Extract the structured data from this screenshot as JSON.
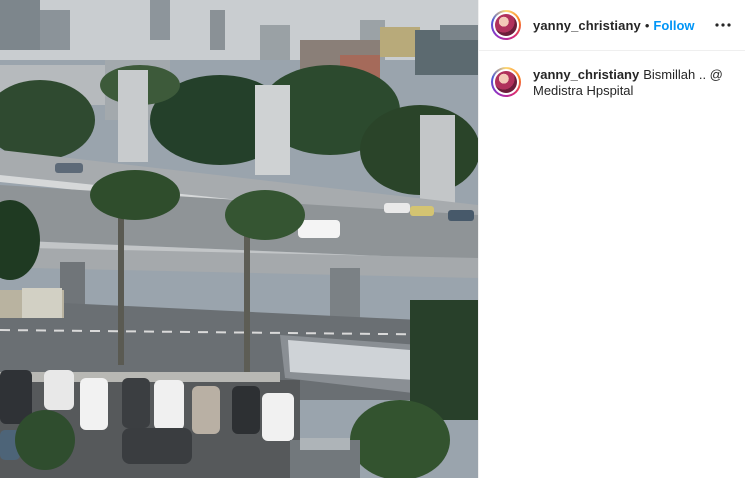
{
  "post": {
    "username": "yanny_christiany",
    "separator": "•",
    "follow_label": "Follow",
    "more_icon": "more-options-icon",
    "caption_text": "Bismillah .. @ Medistra Hpspital",
    "media_description_icon": "photo-media"
  },
  "colors": {
    "follow": "#0095f6",
    "text": "#262626",
    "divider": "#efefef"
  }
}
